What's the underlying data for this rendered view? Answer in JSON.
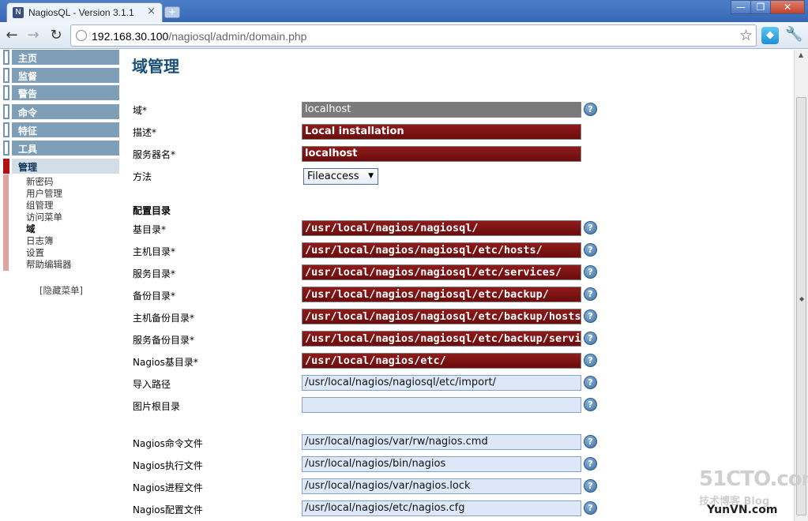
{
  "browser": {
    "tab_title": "NagiosQL - Version 3.1.1",
    "tab_close": "×",
    "new_tab": "+",
    "url_host": "192.168.30.100",
    "url_path": "/nagiosql/admin/domain.php",
    "win_min": "—",
    "win_max": "❐",
    "win_close": "✕"
  },
  "sidebar": {
    "main_items": [
      "主页",
      "监督",
      "警告",
      "命令",
      "特征",
      "工具",
      "管理"
    ],
    "active_item": "管理",
    "sub_items": [
      "新密码",
      "用户管理",
      "组管理",
      "访问菜单",
      "域",
      "日志簿",
      "设置",
      "帮助编辑器"
    ],
    "selected_sub": "域",
    "hide_menu": "[隐藏菜单]"
  },
  "main": {
    "title": "域管理",
    "fields": [
      {
        "label": "域*",
        "value": "localhost",
        "style": "gray",
        "help": true
      },
      {
        "label": "描述*",
        "value": "Local installation",
        "style": "req",
        "help": false
      },
      {
        "label": "服务器名*",
        "value": "localhost",
        "style": "req",
        "help": false
      }
    ],
    "method_label": "方法",
    "method_value": "Fileaccess",
    "section_title": "配置目录",
    "dirs": [
      {
        "label": "基目录*",
        "value": "/usr/local/nagios/nagiosql/",
        "style": "req"
      },
      {
        "label": "主机目录*",
        "value": "/usr/local/nagios/nagiosql/etc/hosts/",
        "style": "req"
      },
      {
        "label": "服务目录*",
        "value": "/usr/local/nagios/nagiosql/etc/services/",
        "style": "req"
      },
      {
        "label": "备份目录*",
        "value": "/usr/local/nagios/nagiosql/etc/backup/",
        "style": "req"
      },
      {
        "label": "主机备份目录*",
        "value": "/usr/local/nagios/nagiosql/etc/backup/hosts/",
        "style": "req"
      },
      {
        "label": "服务备份目录*",
        "value": "/usr/local/nagios/nagiosql/etc/backup/servic",
        "style": "req"
      },
      {
        "label": "Nagios基目录*",
        "value": "/usr/local/nagios/etc/",
        "style": "req"
      },
      {
        "label": "导入路径",
        "value": "/usr/local/nagios/nagiosql/etc/import/",
        "style": "opt"
      },
      {
        "label": "图片根目录",
        "value": "",
        "style": "opt"
      }
    ],
    "files": [
      {
        "label": "Nagios命令文件",
        "value": "/usr/local/nagios/var/rw/nagios.cmd"
      },
      {
        "label": "Nagios执行文件",
        "value": "/usr/local/nagios/bin/nagios"
      },
      {
        "label": "Nagios进程文件",
        "value": "/usr/local/nagios/var/nagios.lock"
      },
      {
        "label": "Nagios配置文件",
        "value": "/usr/local/nagios/etc/nagios.cfg"
      }
    ],
    "help_glyph": "?"
  },
  "watermark": {
    "line1": "51CTO.com",
    "line2": "技术博客 Blog",
    "line3": "YunVN.com"
  },
  "colors": {
    "required_field": "#7a1212",
    "optional_field": "#dce8f8",
    "menu_bar": "#7f9eb7",
    "title": "#1a4e74"
  }
}
